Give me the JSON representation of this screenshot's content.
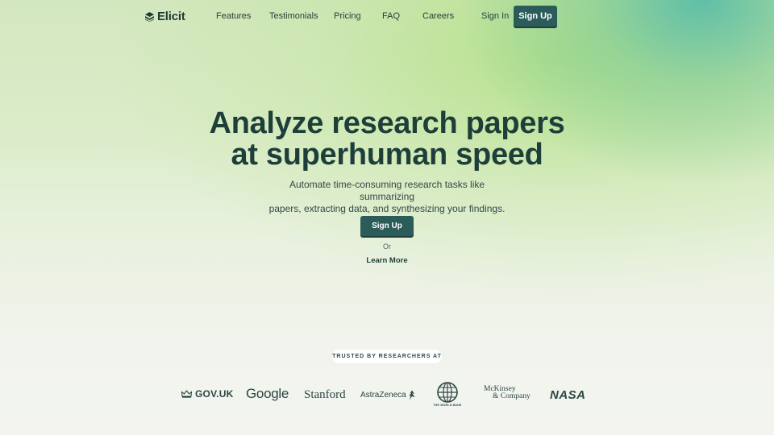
{
  "nav": {
    "brand": "Elicit",
    "links": [
      {
        "label": "Features"
      },
      {
        "label": "Testimonials"
      },
      {
        "label": "Pricing"
      },
      {
        "label": "FAQ"
      },
      {
        "label": "Careers"
      }
    ],
    "sign_in": "Sign In",
    "sign_up": "Sign Up"
  },
  "hero": {
    "title_line1": "Analyze research papers",
    "title_line2": "at superhuman speed",
    "subtitle_line1": "Automate time-consuming research tasks like summarizing",
    "subtitle_line2": "papers, extracting data, and synthesizing your findings.",
    "cta": "Sign Up",
    "or": "Or",
    "learn_more": "Learn More"
  },
  "trust": {
    "badge": "TRUSTED BY RESEARCHERS AT",
    "logos": [
      {
        "name": "gov-uk",
        "text": "GOV.UK",
        "icon": "crown-icon"
      },
      {
        "name": "google",
        "text": "Google"
      },
      {
        "name": "stanford",
        "text": "Stanford"
      },
      {
        "name": "astrazeneca",
        "text": "AstraZeneca",
        "icon": "astrazeneca-symbol-icon"
      },
      {
        "name": "world-bank",
        "text": "THE WORLD BANK",
        "icon": "globe-icon"
      },
      {
        "name": "mckinsey",
        "text_line1": "McKinsey",
        "text_line2": "& Company"
      },
      {
        "name": "nasa",
        "text": "NASA"
      }
    ]
  },
  "colors": {
    "accent": "#2c5c5a",
    "heading": "#1e3e3a",
    "gradient_teal": "#4eb8a8",
    "gradient_green": "#aade78",
    "background_light": "#f3f4f0"
  }
}
